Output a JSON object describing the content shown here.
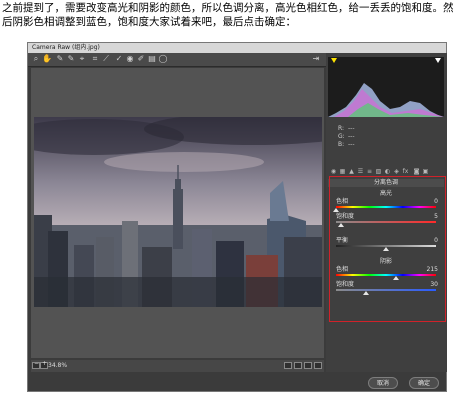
{
  "caption": "之前提到了，需要改变高光和阴影的颜色，所以色调分离，高光色相红色，给一丢丢的饱和度。然后阴影色相调整到蓝色，饱和度大家试着来吧，最后点击确定：",
  "window": {
    "title": "Camera Raw (组内.jpg)"
  },
  "toolbar": {
    "icons": [
      "zoom-icon",
      "hand-icon",
      "white-balance-icon",
      "color-sampler-icon",
      "target-adjust-icon",
      "crop-icon",
      "straighten-icon",
      "spot-removal-icon",
      "redeye-icon",
      "brush-icon",
      "graduated-filter-icon",
      "radial-filter-icon"
    ],
    "glyphs": [
      "⌕",
      "✋",
      "✎",
      "✎",
      "⌖",
      "⌗",
      "⟋",
      "✓",
      "◉",
      "✐",
      "▤",
      "◯"
    ],
    "export_glyph": "⇥"
  },
  "histogram": {
    "readout_labels": [
      "R:",
      "G:",
      "B:"
    ],
    "readout_values": [
      "---",
      "---",
      "---"
    ]
  },
  "panel": {
    "tabs": [
      "◉",
      "▦",
      "▲",
      "☰",
      "≡",
      "▧",
      "◐",
      "◈",
      "fx",
      "◙",
      "▣"
    ],
    "title": "分离色调",
    "highlights": {
      "heading": "高光",
      "hue_label": "色相",
      "hue_value": "0",
      "sat_label": "饱和度",
      "sat_value": "5"
    },
    "balance": {
      "label": "平衡",
      "value": "0"
    },
    "shadows": {
      "heading": "阴影",
      "hue_label": "色相",
      "hue_value": "215",
      "sat_label": "饱和度",
      "sat_value": "30"
    }
  },
  "bottom": {
    "zoom_value": "34.8%",
    "zoom_minus": "−",
    "zoom_plus": "+"
  },
  "buttons": {
    "cancel": "取消",
    "ok": "确定"
  },
  "colors": {
    "accent_red": "#d0222a",
    "window_bg": "#3b3b3b",
    "panel_bg": "#3f3f3f"
  }
}
